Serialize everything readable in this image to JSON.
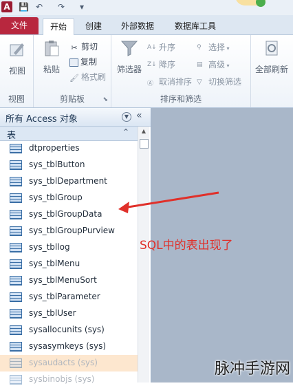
{
  "qat": {
    "app_letter": "A",
    "save": "💾",
    "undo": "↶",
    "redo": "↷",
    "customize": "▾"
  },
  "tabs": [
    "文件",
    "开始",
    "创建",
    "外部数据",
    "数据库工具"
  ],
  "ribbon": {
    "view_group": {
      "view_label": "视图",
      "group_label": "视图"
    },
    "clipboard_group": {
      "paste_label": "粘贴",
      "cut_label": "剪切",
      "copy_label": "复制",
      "format_painter_label": "格式刷",
      "group_label": "剪贴板"
    },
    "sort_filter_group": {
      "filter_label": "筛选器",
      "ascending_label": "升序",
      "descending_label": "降序",
      "remove_sort_label": "取消排序",
      "selection_label": "选择",
      "advanced_label": "高级",
      "toggle_filter_label": "切换筛选",
      "group_label": "排序和筛选"
    },
    "records_group": {
      "refresh_label": "全部刷新"
    }
  },
  "nav_pane": {
    "title": "所有 Access 对象",
    "section": "表",
    "items": [
      "dtproperties",
      "sys_tblButton",
      "sys_tblDepartment",
      "sys_tblGroup",
      "sys_tblGroupData",
      "sys_tblGroupPurview",
      "sys_tbllog",
      "sys_tblMenu",
      "sys_tblMenuSort",
      "sys_tblParameter",
      "sys_tblUser",
      "sysallocunits (sys)",
      "sysasymkeys (sys)",
      "sysaudacts (sys)",
      "sysbinobjs (sys)"
    ]
  },
  "annotation": "SQL中的表出现了",
  "watermark": "脉冲手游网",
  "colors": {
    "file_tab": "#b8273e",
    "annotation": "#e0302a",
    "workspace": "#a9b7c9"
  }
}
